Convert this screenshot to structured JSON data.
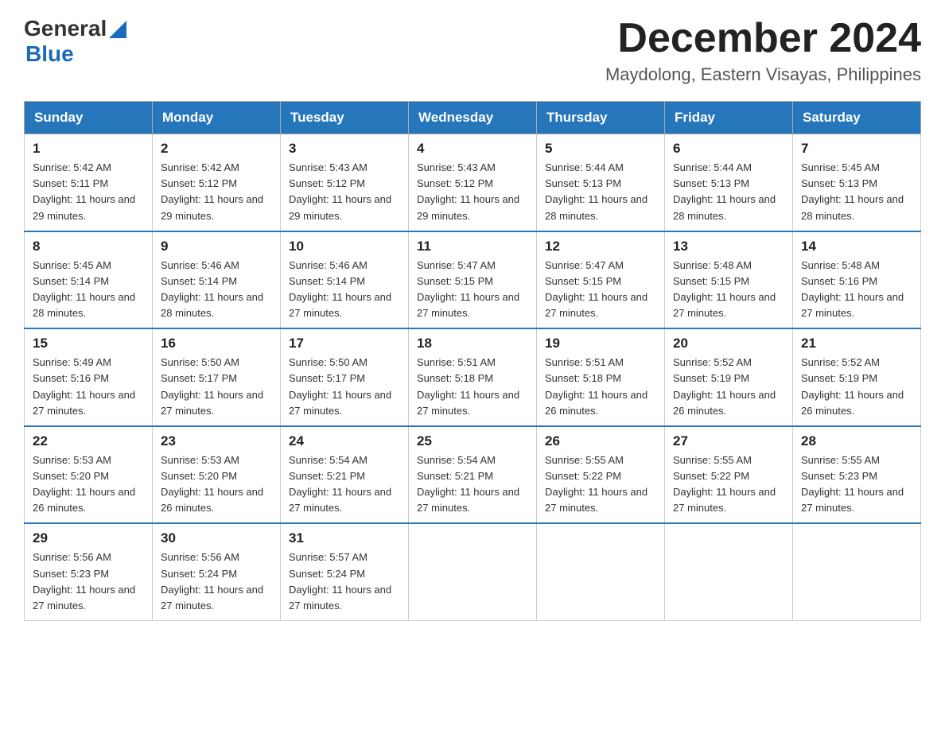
{
  "header": {
    "logo": {
      "general": "General",
      "blue": "Blue",
      "line2": "Blue"
    },
    "title": "December 2024",
    "location": "Maydolong, Eastern Visayas, Philippines"
  },
  "weekdays": [
    "Sunday",
    "Monday",
    "Tuesday",
    "Wednesday",
    "Thursday",
    "Friday",
    "Saturday"
  ],
  "weeks": [
    [
      {
        "day": "1",
        "sunrise": "5:42 AM",
        "sunset": "5:11 PM",
        "daylight": "11 hours and 29 minutes."
      },
      {
        "day": "2",
        "sunrise": "5:42 AM",
        "sunset": "5:12 PM",
        "daylight": "11 hours and 29 minutes."
      },
      {
        "day": "3",
        "sunrise": "5:43 AM",
        "sunset": "5:12 PM",
        "daylight": "11 hours and 29 minutes."
      },
      {
        "day": "4",
        "sunrise": "5:43 AM",
        "sunset": "5:12 PM",
        "daylight": "11 hours and 29 minutes."
      },
      {
        "day": "5",
        "sunrise": "5:44 AM",
        "sunset": "5:13 PM",
        "daylight": "11 hours and 28 minutes."
      },
      {
        "day": "6",
        "sunrise": "5:44 AM",
        "sunset": "5:13 PM",
        "daylight": "11 hours and 28 minutes."
      },
      {
        "day": "7",
        "sunrise": "5:45 AM",
        "sunset": "5:13 PM",
        "daylight": "11 hours and 28 minutes."
      }
    ],
    [
      {
        "day": "8",
        "sunrise": "5:45 AM",
        "sunset": "5:14 PM",
        "daylight": "11 hours and 28 minutes."
      },
      {
        "day": "9",
        "sunrise": "5:46 AM",
        "sunset": "5:14 PM",
        "daylight": "11 hours and 28 minutes."
      },
      {
        "day": "10",
        "sunrise": "5:46 AM",
        "sunset": "5:14 PM",
        "daylight": "11 hours and 27 minutes."
      },
      {
        "day": "11",
        "sunrise": "5:47 AM",
        "sunset": "5:15 PM",
        "daylight": "11 hours and 27 minutes."
      },
      {
        "day": "12",
        "sunrise": "5:47 AM",
        "sunset": "5:15 PM",
        "daylight": "11 hours and 27 minutes."
      },
      {
        "day": "13",
        "sunrise": "5:48 AM",
        "sunset": "5:15 PM",
        "daylight": "11 hours and 27 minutes."
      },
      {
        "day": "14",
        "sunrise": "5:48 AM",
        "sunset": "5:16 PM",
        "daylight": "11 hours and 27 minutes."
      }
    ],
    [
      {
        "day": "15",
        "sunrise": "5:49 AM",
        "sunset": "5:16 PM",
        "daylight": "11 hours and 27 minutes."
      },
      {
        "day": "16",
        "sunrise": "5:50 AM",
        "sunset": "5:17 PM",
        "daylight": "11 hours and 27 minutes."
      },
      {
        "day": "17",
        "sunrise": "5:50 AM",
        "sunset": "5:17 PM",
        "daylight": "11 hours and 27 minutes."
      },
      {
        "day": "18",
        "sunrise": "5:51 AM",
        "sunset": "5:18 PM",
        "daylight": "11 hours and 27 minutes."
      },
      {
        "day": "19",
        "sunrise": "5:51 AM",
        "sunset": "5:18 PM",
        "daylight": "11 hours and 26 minutes."
      },
      {
        "day": "20",
        "sunrise": "5:52 AM",
        "sunset": "5:19 PM",
        "daylight": "11 hours and 26 minutes."
      },
      {
        "day": "21",
        "sunrise": "5:52 AM",
        "sunset": "5:19 PM",
        "daylight": "11 hours and 26 minutes."
      }
    ],
    [
      {
        "day": "22",
        "sunrise": "5:53 AM",
        "sunset": "5:20 PM",
        "daylight": "11 hours and 26 minutes."
      },
      {
        "day": "23",
        "sunrise": "5:53 AM",
        "sunset": "5:20 PM",
        "daylight": "11 hours and 26 minutes."
      },
      {
        "day": "24",
        "sunrise": "5:54 AM",
        "sunset": "5:21 PM",
        "daylight": "11 hours and 27 minutes."
      },
      {
        "day": "25",
        "sunrise": "5:54 AM",
        "sunset": "5:21 PM",
        "daylight": "11 hours and 27 minutes."
      },
      {
        "day": "26",
        "sunrise": "5:55 AM",
        "sunset": "5:22 PM",
        "daylight": "11 hours and 27 minutes."
      },
      {
        "day": "27",
        "sunrise": "5:55 AM",
        "sunset": "5:22 PM",
        "daylight": "11 hours and 27 minutes."
      },
      {
        "day": "28",
        "sunrise": "5:55 AM",
        "sunset": "5:23 PM",
        "daylight": "11 hours and 27 minutes."
      }
    ],
    [
      {
        "day": "29",
        "sunrise": "5:56 AM",
        "sunset": "5:23 PM",
        "daylight": "11 hours and 27 minutes."
      },
      {
        "day": "30",
        "sunrise": "5:56 AM",
        "sunset": "5:24 PM",
        "daylight": "11 hours and 27 minutes."
      },
      {
        "day": "31",
        "sunrise": "5:57 AM",
        "sunset": "5:24 PM",
        "daylight": "11 hours and 27 minutes."
      },
      null,
      null,
      null,
      null
    ]
  ],
  "labels": {
    "sunrise_prefix": "Sunrise: ",
    "sunset_prefix": "Sunset: ",
    "daylight_prefix": "Daylight: "
  }
}
